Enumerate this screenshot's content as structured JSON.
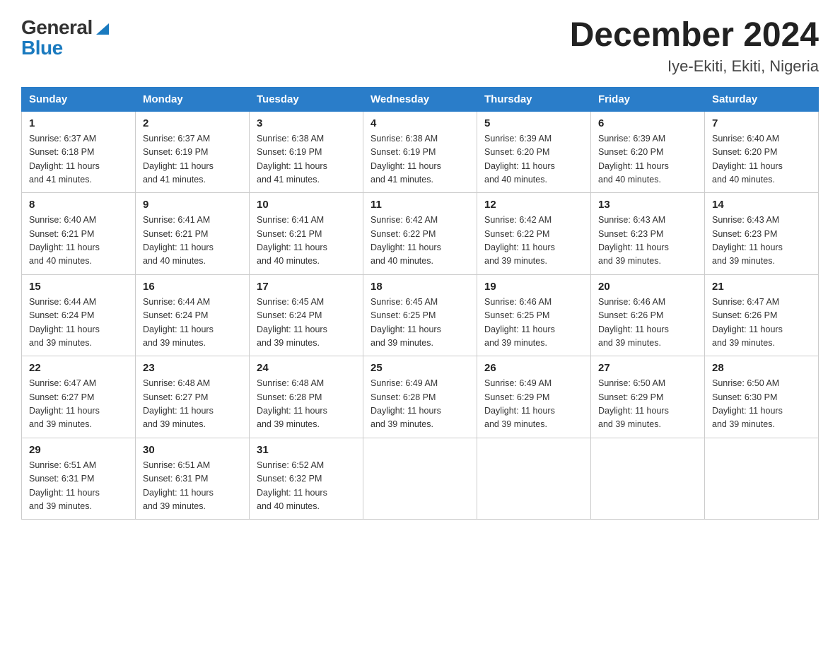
{
  "header": {
    "logo": {
      "text_general": "General",
      "arrow_symbol": "▶",
      "text_blue": "Blue"
    },
    "title": "December 2024",
    "location": "Iye-Ekiti, Ekiti, Nigeria"
  },
  "weekdays": [
    "Sunday",
    "Monday",
    "Tuesday",
    "Wednesday",
    "Thursday",
    "Friday",
    "Saturday"
  ],
  "weeks": [
    [
      {
        "day": "1",
        "sunrise": "6:37 AM",
        "sunset": "6:18 PM",
        "daylight": "11 hours and 41 minutes."
      },
      {
        "day": "2",
        "sunrise": "6:37 AM",
        "sunset": "6:19 PM",
        "daylight": "11 hours and 41 minutes."
      },
      {
        "day": "3",
        "sunrise": "6:38 AM",
        "sunset": "6:19 PM",
        "daylight": "11 hours and 41 minutes."
      },
      {
        "day": "4",
        "sunrise": "6:38 AM",
        "sunset": "6:19 PM",
        "daylight": "11 hours and 41 minutes."
      },
      {
        "day": "5",
        "sunrise": "6:39 AM",
        "sunset": "6:20 PM",
        "daylight": "11 hours and 40 minutes."
      },
      {
        "day": "6",
        "sunrise": "6:39 AM",
        "sunset": "6:20 PM",
        "daylight": "11 hours and 40 minutes."
      },
      {
        "day": "7",
        "sunrise": "6:40 AM",
        "sunset": "6:20 PM",
        "daylight": "11 hours and 40 minutes."
      }
    ],
    [
      {
        "day": "8",
        "sunrise": "6:40 AM",
        "sunset": "6:21 PM",
        "daylight": "11 hours and 40 minutes."
      },
      {
        "day": "9",
        "sunrise": "6:41 AM",
        "sunset": "6:21 PM",
        "daylight": "11 hours and 40 minutes."
      },
      {
        "day": "10",
        "sunrise": "6:41 AM",
        "sunset": "6:21 PM",
        "daylight": "11 hours and 40 minutes."
      },
      {
        "day": "11",
        "sunrise": "6:42 AM",
        "sunset": "6:22 PM",
        "daylight": "11 hours and 40 minutes."
      },
      {
        "day": "12",
        "sunrise": "6:42 AM",
        "sunset": "6:22 PM",
        "daylight": "11 hours and 39 minutes."
      },
      {
        "day": "13",
        "sunrise": "6:43 AM",
        "sunset": "6:23 PM",
        "daylight": "11 hours and 39 minutes."
      },
      {
        "day": "14",
        "sunrise": "6:43 AM",
        "sunset": "6:23 PM",
        "daylight": "11 hours and 39 minutes."
      }
    ],
    [
      {
        "day": "15",
        "sunrise": "6:44 AM",
        "sunset": "6:24 PM",
        "daylight": "11 hours and 39 minutes."
      },
      {
        "day": "16",
        "sunrise": "6:44 AM",
        "sunset": "6:24 PM",
        "daylight": "11 hours and 39 minutes."
      },
      {
        "day": "17",
        "sunrise": "6:45 AM",
        "sunset": "6:24 PM",
        "daylight": "11 hours and 39 minutes."
      },
      {
        "day": "18",
        "sunrise": "6:45 AM",
        "sunset": "6:25 PM",
        "daylight": "11 hours and 39 minutes."
      },
      {
        "day": "19",
        "sunrise": "6:46 AM",
        "sunset": "6:25 PM",
        "daylight": "11 hours and 39 minutes."
      },
      {
        "day": "20",
        "sunrise": "6:46 AM",
        "sunset": "6:26 PM",
        "daylight": "11 hours and 39 minutes."
      },
      {
        "day": "21",
        "sunrise": "6:47 AM",
        "sunset": "6:26 PM",
        "daylight": "11 hours and 39 minutes."
      }
    ],
    [
      {
        "day": "22",
        "sunrise": "6:47 AM",
        "sunset": "6:27 PM",
        "daylight": "11 hours and 39 minutes."
      },
      {
        "day": "23",
        "sunrise": "6:48 AM",
        "sunset": "6:27 PM",
        "daylight": "11 hours and 39 minutes."
      },
      {
        "day": "24",
        "sunrise": "6:48 AM",
        "sunset": "6:28 PM",
        "daylight": "11 hours and 39 minutes."
      },
      {
        "day": "25",
        "sunrise": "6:49 AM",
        "sunset": "6:28 PM",
        "daylight": "11 hours and 39 minutes."
      },
      {
        "day": "26",
        "sunrise": "6:49 AM",
        "sunset": "6:29 PM",
        "daylight": "11 hours and 39 minutes."
      },
      {
        "day": "27",
        "sunrise": "6:50 AM",
        "sunset": "6:29 PM",
        "daylight": "11 hours and 39 minutes."
      },
      {
        "day": "28",
        "sunrise": "6:50 AM",
        "sunset": "6:30 PM",
        "daylight": "11 hours and 39 minutes."
      }
    ],
    [
      {
        "day": "29",
        "sunrise": "6:51 AM",
        "sunset": "6:31 PM",
        "daylight": "11 hours and 39 minutes."
      },
      {
        "day": "30",
        "sunrise": "6:51 AM",
        "sunset": "6:31 PM",
        "daylight": "11 hours and 39 minutes."
      },
      {
        "day": "31",
        "sunrise": "6:52 AM",
        "sunset": "6:32 PM",
        "daylight": "11 hours and 40 minutes."
      },
      null,
      null,
      null,
      null
    ]
  ],
  "labels": {
    "sunrise": "Sunrise:",
    "sunset": "Sunset:",
    "daylight": "Daylight:"
  }
}
